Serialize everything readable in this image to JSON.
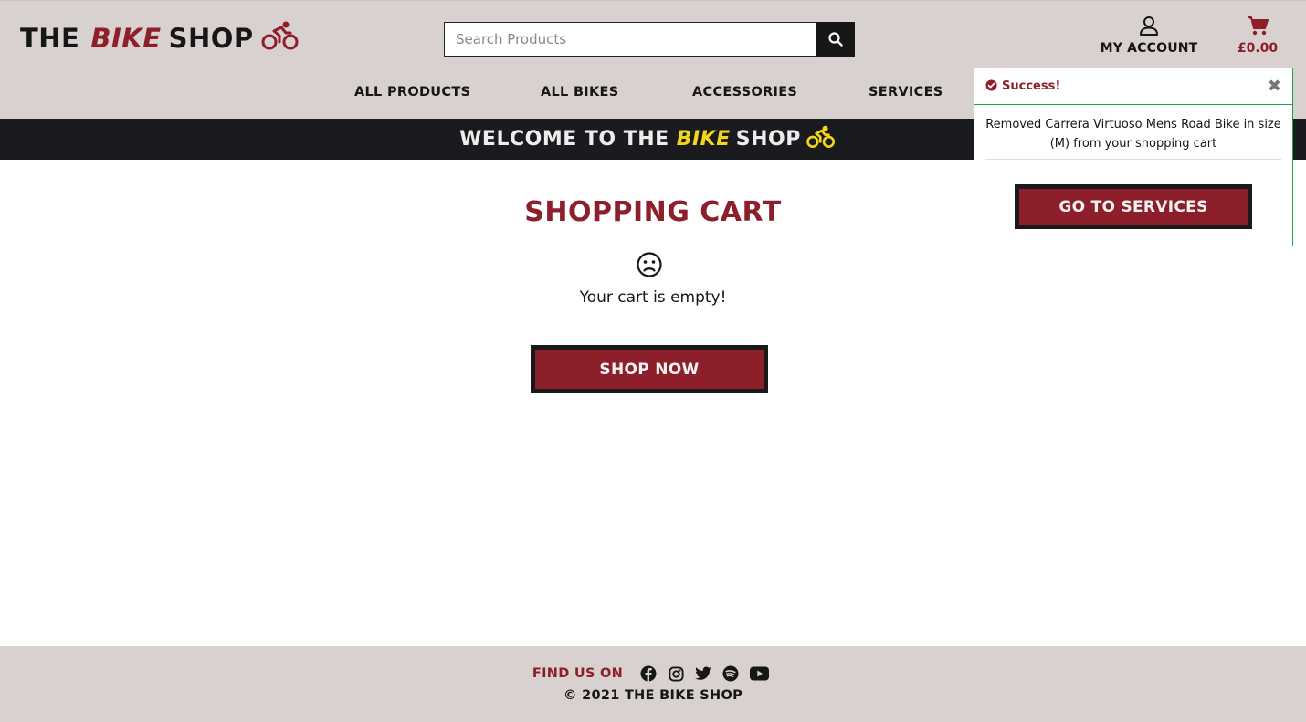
{
  "header": {
    "logo": {
      "part1": "THE",
      "part2": "BIKE",
      "part3": "SHOP"
    },
    "search": {
      "placeholder": "Search Products"
    },
    "account_label": "MY ACCOUNT",
    "cart_total": "£0.00"
  },
  "nav": {
    "items": [
      {
        "label": "ALL PRODUCTS"
      },
      {
        "label": "ALL BIKES"
      },
      {
        "label": "ACCESSORIES"
      },
      {
        "label": "SERVICES"
      }
    ]
  },
  "banner": {
    "part1": "WELCOME TO THE",
    "part2": "BIKE",
    "part3": "SHOP"
  },
  "cart_page": {
    "title": "SHOPPING CART",
    "empty_text": "Your cart is empty!",
    "shop_now": "SHOP NOW"
  },
  "toast": {
    "title": "Success!",
    "message": "Removed Carrera Virtuoso Mens Road Bike in size (M) from your shopping cart",
    "button": "GO TO SERVICES"
  },
  "footer": {
    "find_us": "FIND US ON",
    "social": [
      "facebook-icon",
      "instagram-icon",
      "twitter-icon",
      "spotify-icon",
      "youtube-icon"
    ],
    "copyright": "© 2021 THE BIKE SHOP"
  },
  "colors": {
    "brand": "#8c1f2a",
    "banner_bg": "#1a1b1f",
    "accent_yellow": "#f3d61a",
    "header_bg": "#d9d0d0",
    "success": "#1aa64b"
  }
}
